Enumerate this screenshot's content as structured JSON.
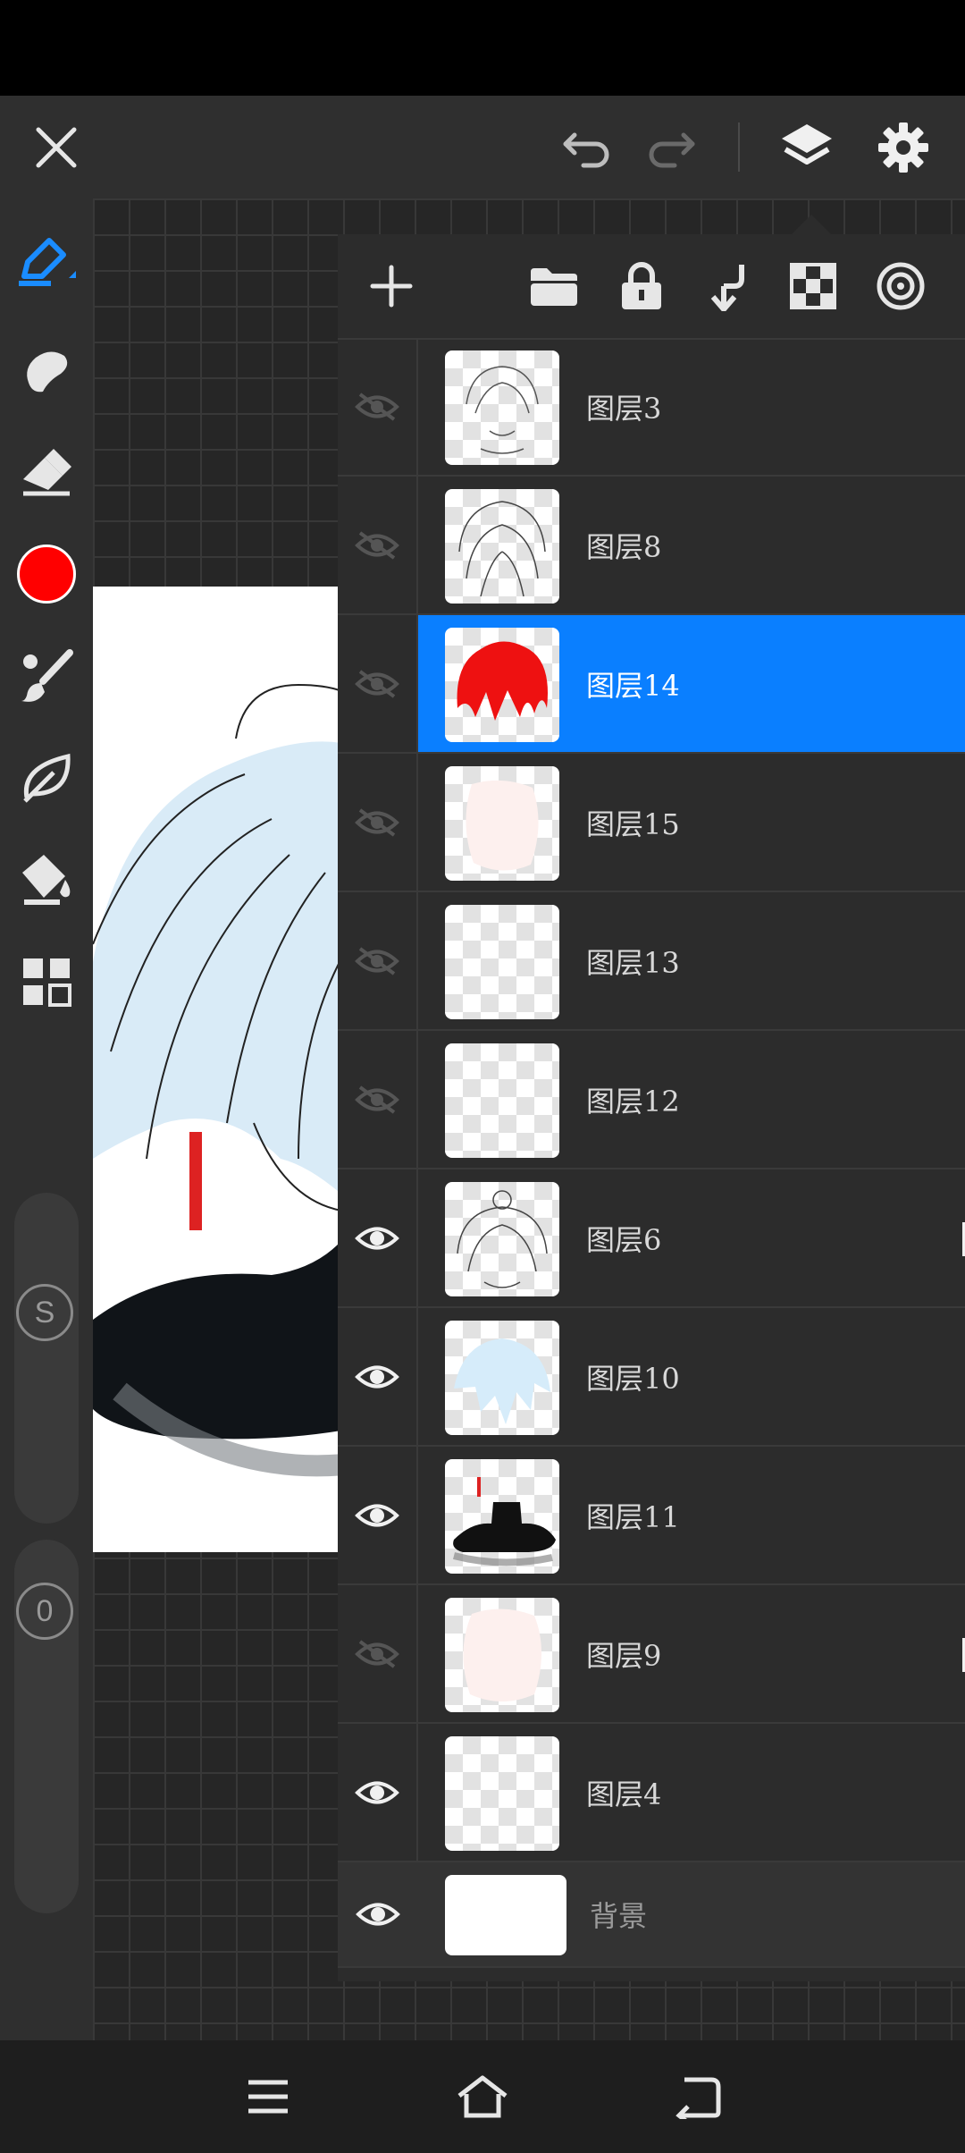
{
  "layers": [
    {
      "name": "图层3"
    },
    {
      "name": "图层8"
    },
    {
      "name": "图层14"
    },
    {
      "name": "图层15"
    },
    {
      "name": "图层13"
    },
    {
      "name": "图层12"
    },
    {
      "name": "图层6"
    },
    {
      "name": "图层10"
    },
    {
      "name": "图层11"
    },
    {
      "name": "图层9"
    },
    {
      "name": "图层4"
    },
    {
      "name": "背景"
    }
  ],
  "toolbar": {
    "size_slider_label": "S",
    "opacity_slider_label": "0",
    "current_color": "#ff0000"
  },
  "colors": {
    "accent": "#0a7fff",
    "panel": "#2c2c2c",
    "icon": "#e0e0e0"
  }
}
